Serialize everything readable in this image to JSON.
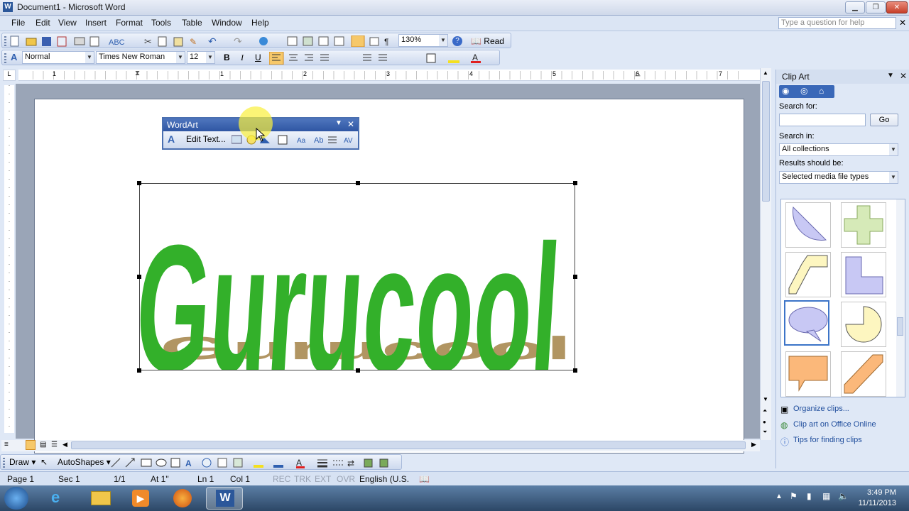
{
  "window": {
    "title": "Document1 - Microsoft Word"
  },
  "menu": {
    "items": [
      "File",
      "Edit",
      "View",
      "Insert",
      "Format",
      "Tools",
      "Table",
      "Window",
      "Help"
    ],
    "ask_placeholder": "Type a question for help"
  },
  "standard_toolbar": {
    "zoom": "130%",
    "read_label": "Read"
  },
  "formatting_toolbar": {
    "style": "Normal",
    "font": "Times New Roman",
    "size": "12",
    "bold": "B",
    "italic": "I",
    "underline": "U"
  },
  "ruler": {
    "marks": [
      "1",
      "1",
      "2",
      "3",
      "4",
      "5",
      "6",
      "7"
    ]
  },
  "wordart_toolbar": {
    "title": "WordArt",
    "edit_text": "Edit Text..."
  },
  "wordart": {
    "text": "Gurucool",
    "fill_color": "#33b02a",
    "shadow_color": "#a98a52"
  },
  "taskpane": {
    "title": "Clip Art",
    "search_for_label": "Search for:",
    "search_value": "",
    "go_label": "Go",
    "search_in_label": "Search in:",
    "search_in_value": "All collections",
    "results_label": "Results should be:",
    "results_value": "Selected media file types",
    "links": [
      "Organize clips...",
      "Clip art on Office Online",
      "Tips for finding clips"
    ],
    "clips": [
      "half-circle-shape",
      "plus-shape",
      "step-shape",
      "l-shape",
      "speech-bubble-shape",
      "pie-shape",
      "callout-shape",
      "diagonal-band-shape"
    ]
  },
  "draw_toolbar": {
    "draw": "Draw",
    "autoshapes": "AutoShapes"
  },
  "status": {
    "page": "Page 1",
    "sec": "Sec 1",
    "pages": "1/1",
    "at": "At 1\"",
    "ln": "Ln 1",
    "col": "Col 1",
    "rec": "REC",
    "trk": "TRK",
    "ext": "EXT",
    "ovr": "OVR",
    "lang": "English (U.S."
  },
  "taskbar": {
    "time": "3:49 PM",
    "date": "11/11/2013"
  },
  "colors": {
    "accent": "#2f56a3",
    "wordart_green": "#33b02a"
  }
}
